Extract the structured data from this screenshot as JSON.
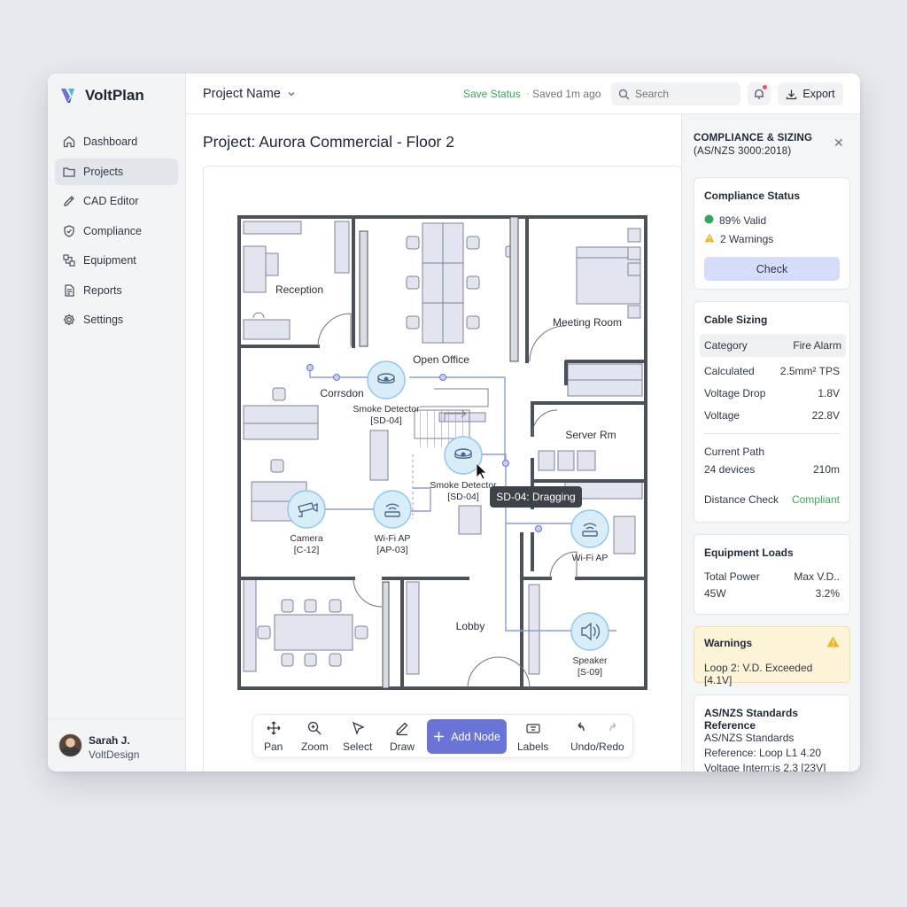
{
  "app": {
    "name": "VoltPlan"
  },
  "sidebar": {
    "items": [
      {
        "label": "Dashboard",
        "icon": "home-icon"
      },
      {
        "label": "Projects",
        "icon": "folder-icon"
      },
      {
        "label": "CAD Editor",
        "icon": "pencil-icon"
      },
      {
        "label": "Compliance",
        "icon": "shield-check-icon"
      },
      {
        "label": "Equipment",
        "icon": "equipment-icon"
      },
      {
        "label": "Reports",
        "icon": "document-icon"
      },
      {
        "label": "Settings",
        "icon": "gear-icon"
      }
    ],
    "active": "Projects",
    "user": {
      "name": "Sarah J.",
      "org": "VoltDesign"
    }
  },
  "topbar": {
    "project_name": "Project Name",
    "save_status": "Save Status",
    "saved": "Saved 1m ago",
    "search_placeholder": "Search",
    "export_label": "Export"
  },
  "main": {
    "title": "Project: Aurora Commercial - Floor 2",
    "rooms": {
      "reception": "Reception",
      "open_office": "Open Office",
      "meeting_room": "Meeting Room",
      "corridor": "Corrsdon",
      "server_room": "Server Rm",
      "lobby": "Lobby"
    },
    "devices": [
      {
        "type": "Smoke Detector",
        "id": "[SD-04]"
      },
      {
        "type": "Smoke Detector",
        "id": "[SD-04]"
      },
      {
        "type": "Camera",
        "id": "[C-12]"
      },
      {
        "type": "Wi-Fi AP",
        "id": "[AP-03]"
      },
      {
        "type": "Wi-Fi AP",
        "id": ""
      },
      {
        "type": "Speaker",
        "id": "[S-09]"
      }
    ],
    "tooltip": "SD-04: Dragging",
    "colors": {
      "node_fill": "#d9edf9",
      "node_stroke": "#8ec8ea",
      "cable": "#8e9bdc",
      "wall": "#4b5159",
      "furniture": "#e2e4f0"
    }
  },
  "toolbar": {
    "pan": "Pan",
    "zoom": "Zoom",
    "select": "Select",
    "draw": "Draw",
    "add_node": "Add Node",
    "labels": "Labels",
    "undo_redo": "Undo/Redo"
  },
  "panel": {
    "title": "COMPLIANCE & SIZING",
    "subtitle": "(AS/NZS 3000:2018)",
    "compliance": {
      "title": "Compliance Status",
      "valid": "89% Valid",
      "warnings": "2 Warnings",
      "check_label": "Check"
    },
    "cable": {
      "title": "Cable Sizing",
      "category_label": "Category",
      "category_value": "Fire Alarm",
      "calculated_label": "Calculated",
      "calculated_value": "2.5mm² TPS",
      "vdrop_label": "Voltage Drop",
      "vdrop_value": "1.8V",
      "voltage_label": "Voltage",
      "voltage_value": "22.8V",
      "path_label": "Current Path",
      "devices": "24 devices",
      "distance": "210m",
      "dcheck_label": "Distance Check",
      "dcheck_value": "Compliant"
    },
    "loads": {
      "title": "Equipment Loads",
      "total_label": "Total Power",
      "max_label": "Max V.D..",
      "total_value": "45W",
      "max_value": "3.2%"
    },
    "warnings": {
      "title": "Warnings",
      "text": "Loop 2: V.D. Exceeded [4.1V]"
    },
    "standards": {
      "title": "AS/NZS Standards Reference",
      "line1": "AS/NZS Standards",
      "line2": "Reference: Loop L1 4.20",
      "line3": "Voltage Intern:is 2.3 [23V]"
    },
    "colors": {
      "valid": "#2fa95a",
      "warning": "#f0b429"
    }
  }
}
